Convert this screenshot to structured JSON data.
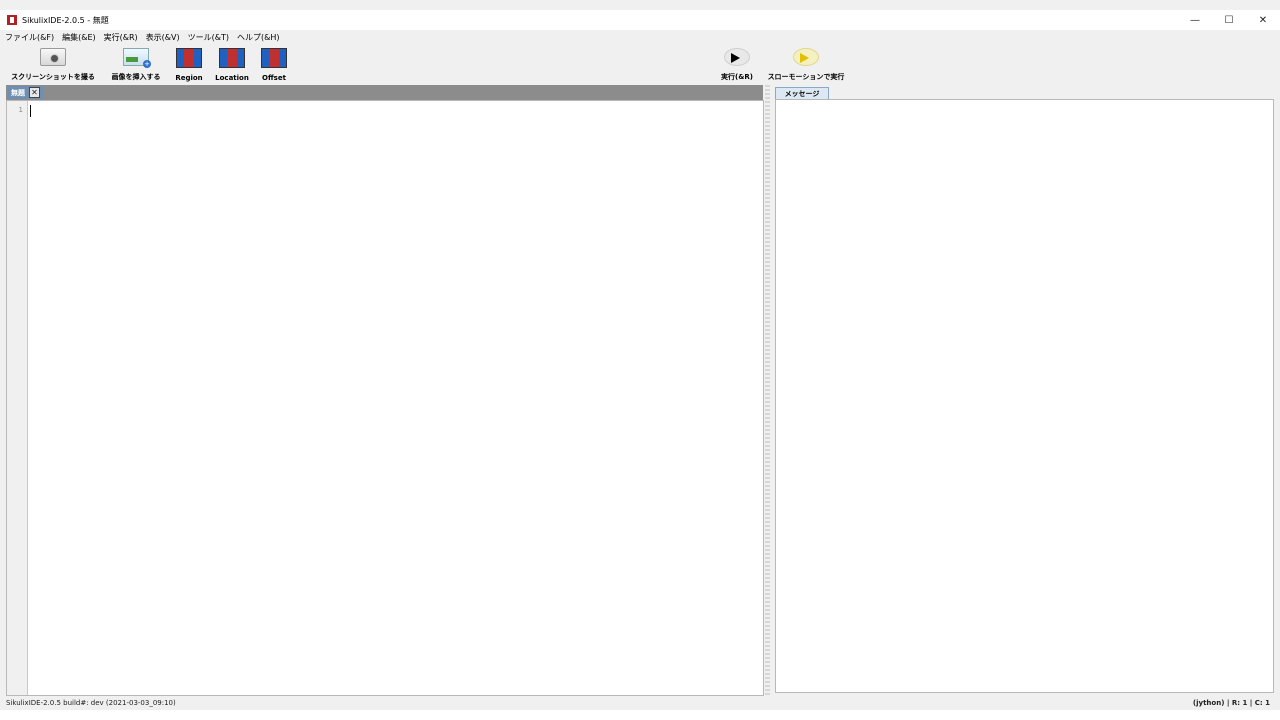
{
  "window": {
    "title": "SikulixIDE-2.0.5 - 無題",
    "controls": {
      "minimize": "—",
      "maximize": "☐",
      "close": "✕"
    }
  },
  "menu": {
    "items": [
      "ファイル(&F)",
      "編集(&E)",
      "実行(&R)",
      "表示(&V)",
      "ツール(&T)",
      "ヘルプ(&H)"
    ]
  },
  "toolbar": {
    "screenshot_label": "スクリーンショットを撮る",
    "insert_image_label": "画像を挿入する",
    "region_label": "Region",
    "location_label": "Location",
    "offset_label": "Offset",
    "run_label": "実行(&R)",
    "slow_run_label": "スローモーションで実行"
  },
  "editor": {
    "tab_label": "無題",
    "close_glyph": "✕",
    "line_number": "1"
  },
  "message_panel": {
    "tab_label": "メッセージ"
  },
  "status": {
    "left": "SikulixIDE-2.0.5 build#: dev (2021-03-03_09:10)",
    "right": "(jython) | R: 1 | C: 1"
  },
  "icons": {
    "app": "sikulix-app-icon",
    "screenshot": "camera-icon",
    "insert_image": "insert-image-icon",
    "region": "region-icon",
    "location": "location-icon",
    "offset": "offset-icon",
    "run": "play-icon",
    "slow_run": "slow-play-icon"
  }
}
